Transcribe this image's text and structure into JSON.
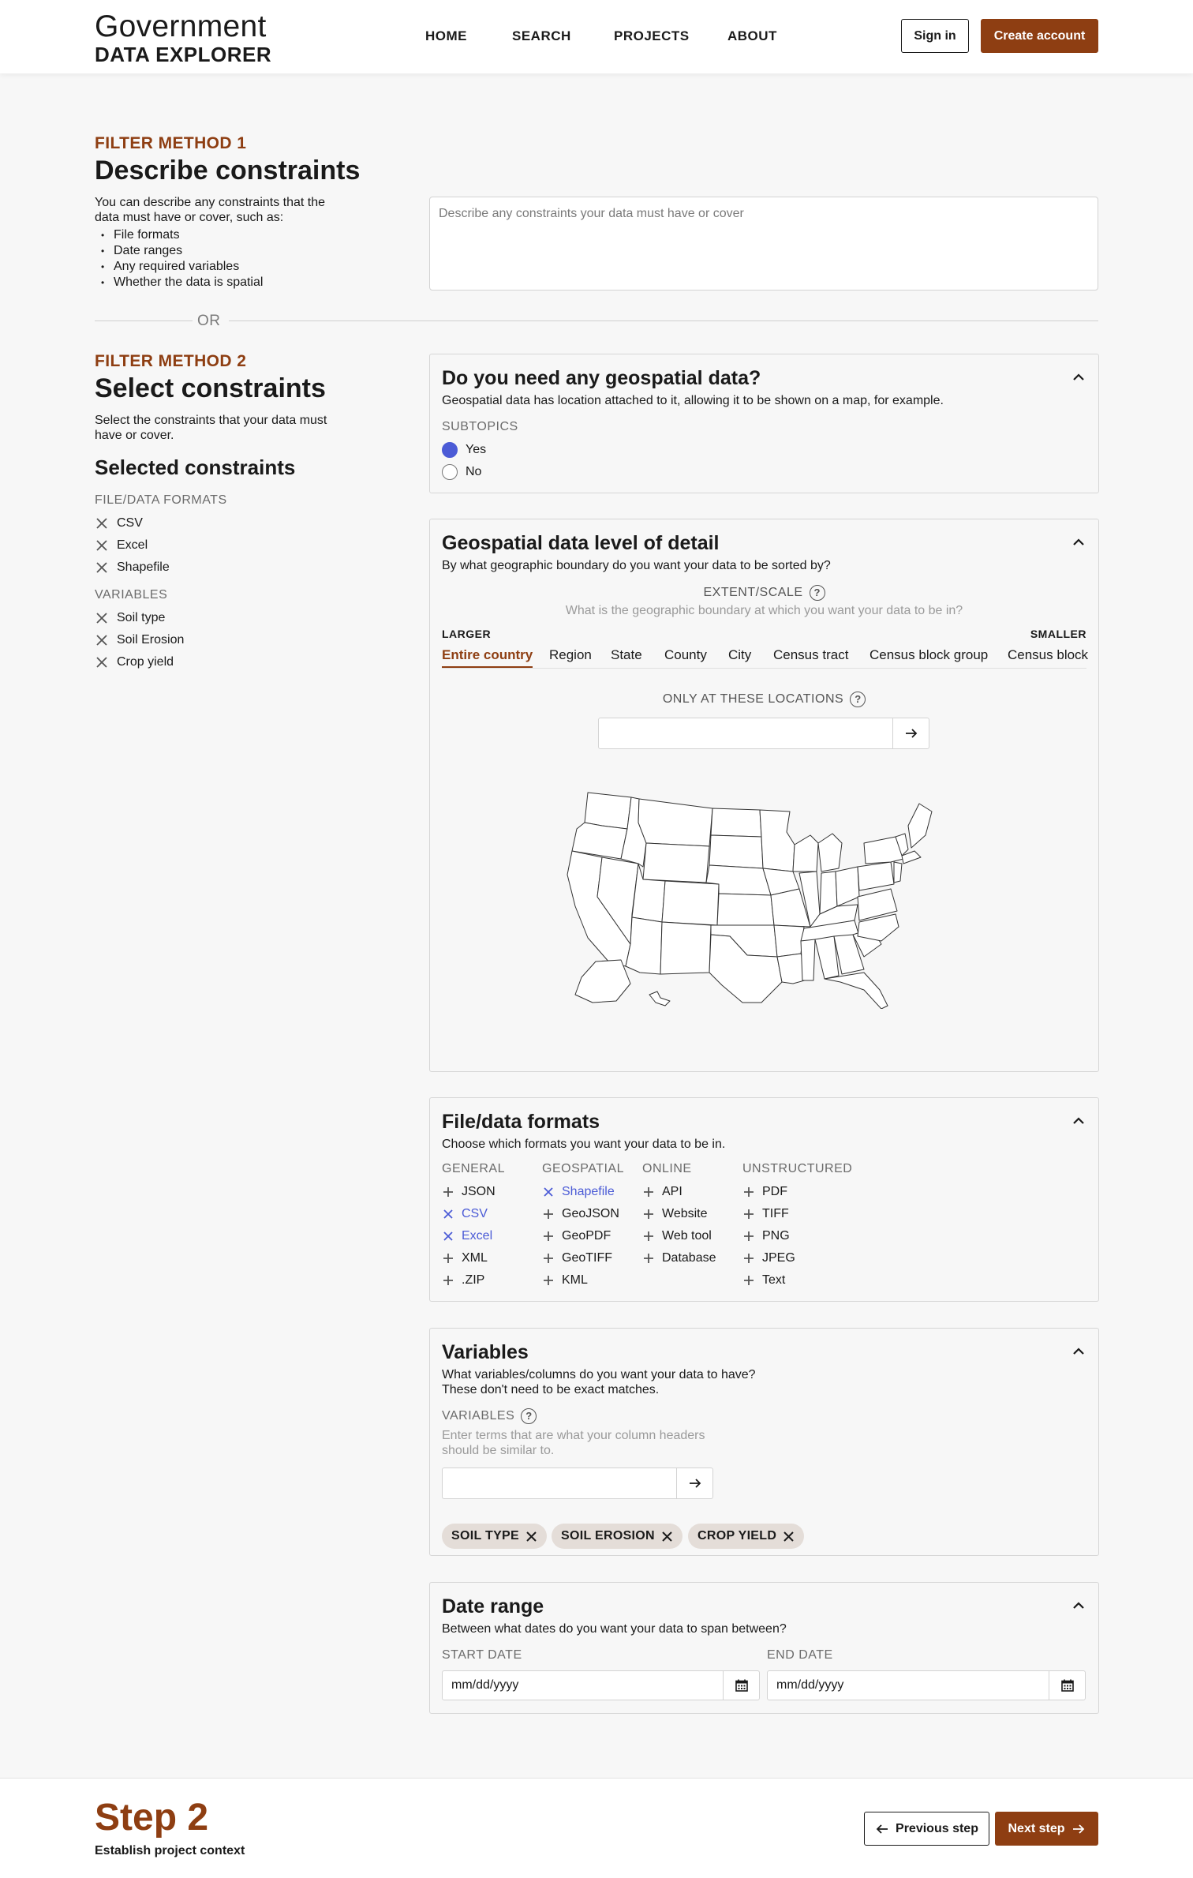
{
  "header": {
    "logo_top": "Government",
    "logo_bottom": "DATA EXPLORER",
    "nav": [
      "HOME",
      "SEARCH",
      "PROJECTS",
      "ABOUT"
    ],
    "sign_in": "Sign in",
    "create_account": "Create account"
  },
  "method1": {
    "eyebrow": "FILTER METHOD 1",
    "title": "Describe constraints",
    "desc_line1": "You can describe any constraints that the",
    "desc_line2": "data must have or cover, such as:",
    "bullets": [
      "File formats",
      "Date ranges",
      "Any required variables",
      "Whether the data is spatial"
    ],
    "placeholder": "Describe any constraints your data must have or cover"
  },
  "or_label": "OR",
  "method2": {
    "eyebrow": "FILTER METHOD 2",
    "title": "Select constraints",
    "desc_line1": "Select the constraints that your data must",
    "desc_line2": "have or cover.",
    "selected_title": "Selected constraints",
    "formats_label": "FILE/DATA FORMATS",
    "formats": [
      "CSV",
      "Excel",
      "Shapefile"
    ],
    "variables_label": "VARIABLES",
    "variables": [
      "Soil type",
      "Soil Erosion",
      "Crop yield"
    ]
  },
  "geospatial": {
    "title": "Do you need any geospatial data?",
    "subtitle": "Geospatial data has location attached to it, allowing it to be shown on a map, for example.",
    "subtopics_label": "SUBTOPICS",
    "options": [
      "Yes",
      "No"
    ],
    "selected": "Yes"
  },
  "detail": {
    "title": "Geospatial data level of detail",
    "subtitle": "By what geographic boundary do you want your data to be sorted by?",
    "extent_label": "EXTENT/SCALE",
    "extent_help": "What is the geographic boundary at which you want your data to be in?",
    "larger": "LARGER",
    "smaller": "SMALLER",
    "scales": [
      "Entire country",
      "Region",
      "State",
      "County",
      "City",
      "Census tract",
      "Census block group",
      "Census block"
    ],
    "active_scale": "Entire country",
    "locations_label": "ONLY AT THESE LOCATIONS"
  },
  "formats": {
    "title": "File/data formats",
    "subtitle": "Choose which formats you want your data to be in.",
    "columns": [
      {
        "header": "GENERAL",
        "items": [
          {
            "label": "JSON",
            "selected": false
          },
          {
            "label": "CSV",
            "selected": true
          },
          {
            "label": "Excel",
            "selected": true
          },
          {
            "label": "XML",
            "selected": false
          },
          {
            "label": ".ZIP",
            "selected": false
          }
        ]
      },
      {
        "header": "GEOSPATIAL",
        "items": [
          {
            "label": "Shapefile",
            "selected": true
          },
          {
            "label": "GeoJSON",
            "selected": false
          },
          {
            "label": "GeoPDF",
            "selected": false
          },
          {
            "label": "GeoTIFF",
            "selected": false
          },
          {
            "label": "KML",
            "selected": false
          }
        ]
      },
      {
        "header": "ONLINE",
        "items": [
          {
            "label": "API",
            "selected": false
          },
          {
            "label": "Website",
            "selected": false
          },
          {
            "label": "Web tool",
            "selected": false
          },
          {
            "label": "Database",
            "selected": false
          }
        ]
      },
      {
        "header": "UNSTRUCTURED",
        "items": [
          {
            "label": "PDF",
            "selected": false
          },
          {
            "label": "TIFF",
            "selected": false
          },
          {
            "label": "PNG",
            "selected": false
          },
          {
            "label": "JPEG",
            "selected": false
          },
          {
            "label": "Text",
            "selected": false
          }
        ]
      }
    ],
    "selected_color": "#4b5bd6"
  },
  "variables": {
    "title": "Variables",
    "subtitle_line1": "What variables/columns do you want your data to have?",
    "subtitle_line2": "These don't need to be exact matches.",
    "label": "VARIABLES",
    "hint_line1": "Enter terms that are what your column headers",
    "hint_line2": "should be similar to.",
    "chips": [
      "SOIL TYPE",
      "SOIL EROSION",
      "CROP YIELD"
    ]
  },
  "dates": {
    "title": "Date range",
    "subtitle": "Between what dates do you want your data to span between?",
    "start_label": "START DATE",
    "end_label": "END DATE",
    "start_placeholder": "mm/dd/yyyy",
    "end_placeholder": "mm/dd/yyyy"
  },
  "footer": {
    "step": "Step 2",
    "step_desc": "Establish project context",
    "prev": "Previous step",
    "next": "Next step"
  },
  "colors": {
    "accent": "#8e3e12",
    "selection": "#4b5bd6"
  }
}
